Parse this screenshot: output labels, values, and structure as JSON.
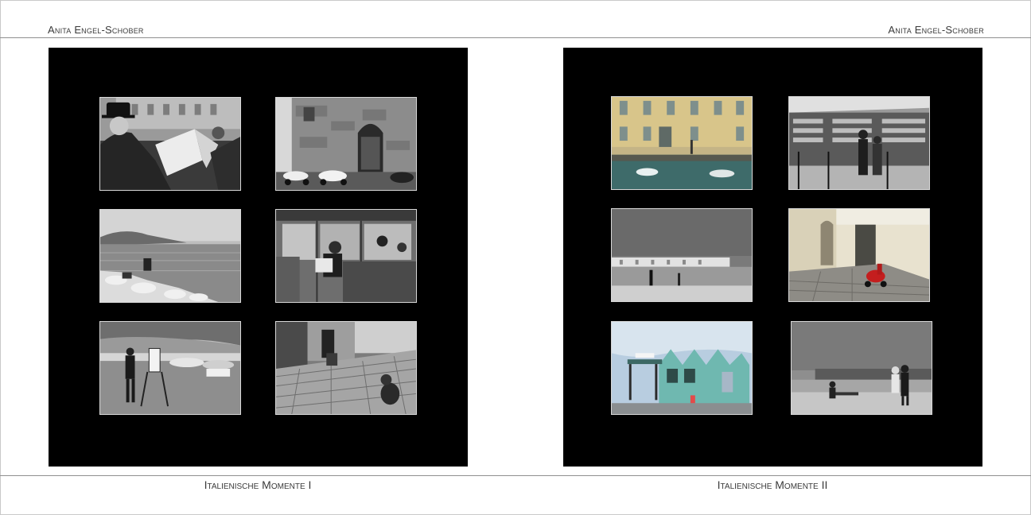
{
  "header": {
    "author_left": "Anita Engel-Schober",
    "author_right": "Anita Engel-Schober"
  },
  "footer": {
    "caption_left": "Italienische Momente I",
    "caption_right": "Italienische Momente II"
  },
  "pages": [
    {
      "name": "left-page",
      "photos": [
        {
          "subject": "man-reading-newspaper",
          "color": false
        },
        {
          "subject": "stone-house-scooters",
          "color": false
        },
        {
          "subject": "seaside-rocks",
          "color": false
        },
        {
          "subject": "tram-passengers",
          "color": false
        },
        {
          "subject": "beach-painter",
          "color": false
        },
        {
          "subject": "alley-cat",
          "color": false
        }
      ]
    },
    {
      "name": "right-page",
      "photos": [
        {
          "subject": "canal-boats",
          "color": true
        },
        {
          "subject": "book-stall",
          "color": false
        },
        {
          "subject": "harbor-pier",
          "color": false
        },
        {
          "subject": "red-vespa-alley",
          "color": true
        },
        {
          "subject": "chalet-kiosk",
          "color": true
        },
        {
          "subject": "waterfront-promenade",
          "color": false
        }
      ]
    }
  ]
}
